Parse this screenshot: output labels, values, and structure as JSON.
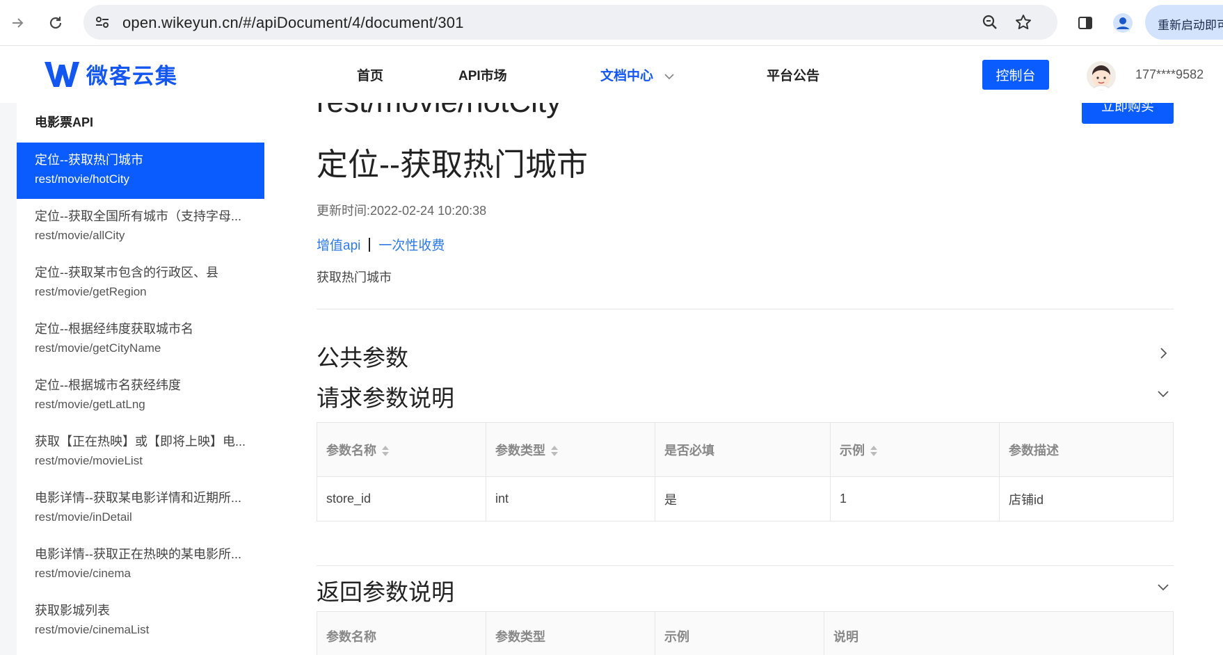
{
  "browser": {
    "url": "open.wikeyun.cn/#/apiDocument/4/document/301",
    "restart_label": "重新启动即可更新",
    "icons": [
      "forward-icon",
      "reload-icon",
      "site-settings-icon",
      "zoom-icon",
      "bookmark-star-icon",
      "side-panel-icon",
      "profile-icon"
    ]
  },
  "header": {
    "logo_text": "微客云集",
    "nav": [
      {
        "label": "首页"
      },
      {
        "label": "API市场"
      },
      {
        "label": "文档中心",
        "active": true
      },
      {
        "label": "平台公告"
      }
    ],
    "console_label": "控制台",
    "phone": "177****9582"
  },
  "sidebar": {
    "title": "电影票API",
    "items": [
      {
        "title": "定位--获取热门城市",
        "path": "rest/movie/hotCity",
        "active": true
      },
      {
        "title": "定位--获取全国所有城市（支持字母...",
        "path": "rest/movie/allCity"
      },
      {
        "title": "定位--获取某市包含的行政区、县",
        "path": "rest/movie/getRegion"
      },
      {
        "title": "定位--根据经纬度获取城市名",
        "path": "rest/movie/getCityName"
      },
      {
        "title": "定位--根据城市名获经纬度",
        "path": "rest/movie/getLatLng"
      },
      {
        "title": "获取【正在热映】或【即将上映】电...",
        "path": "rest/movie/movieList"
      },
      {
        "title": "电影详情--获取某电影详情和近期所...",
        "path": "rest/movie/inDetail"
      },
      {
        "title": "电影详情--获取正在热映的某电影所...",
        "path": "rest/movie/cinema"
      },
      {
        "title": "获取影城列表",
        "path": "rest/movie/cinemaList"
      }
    ]
  },
  "main": {
    "cut_title": "rest/movie/hotCity",
    "buy_label": "立即购买",
    "title": "定位--获取热门城市",
    "update_time": "更新时间:2022-02-24 10:20:38",
    "tag1": "增值api",
    "tag2": "一次性收费",
    "desc": "获取热门城市",
    "public_params": "公共参数",
    "request_params": "请求参数说明",
    "request_table": {
      "headers": [
        "参数名称",
        "参数类型",
        "是否必填",
        "示例",
        "参数描述"
      ],
      "rows": [
        [
          "store_id",
          "int",
          "是",
          "1",
          "店铺id"
        ]
      ]
    },
    "response_params": "返回参数说明",
    "response_table": {
      "headers": [
        "参数名称",
        "参数类型",
        "示例",
        "说明"
      ]
    }
  }
}
